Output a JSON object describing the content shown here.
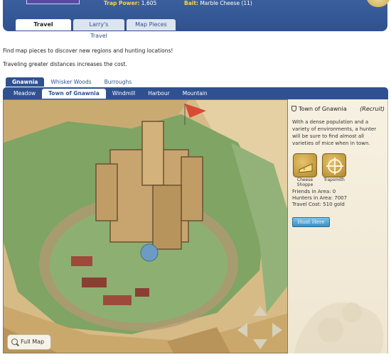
{
  "header": {
    "trap_power_label": "Trap Power:",
    "trap_power_value": "1,605",
    "bait_label": "Bait:",
    "bait_value": "Marble Cheese (11)"
  },
  "main_tabs": [
    {
      "label": "Travel",
      "active": true
    },
    {
      "label": "Larry's Travel",
      "active": false
    },
    {
      "label": "Map Pieces",
      "active": false
    }
  ],
  "intro": {
    "line1": "Find map pieces to discover new regions and hunting locations!",
    "line2": "Traveling greater distances increases the cost."
  },
  "region_tabs": [
    {
      "label": "Gnawnia",
      "active": true
    },
    {
      "label": "Whisker Woods",
      "active": false
    },
    {
      "label": "Burroughs",
      "active": false
    }
  ],
  "location_tabs": [
    {
      "label": "Meadow",
      "active": false
    },
    {
      "label": "Town of Gnawnia",
      "active": true
    },
    {
      "label": "Windmill",
      "active": false
    },
    {
      "label": "Harbour",
      "active": false
    },
    {
      "label": "Mountain",
      "active": false
    }
  ],
  "location": {
    "name": "Town of Gnawnia",
    "rank": "(Recruit)",
    "description": "With a dense population and a variety of environments, a hunter will be sure to find almost all varieties of mice when in town.",
    "shops": [
      {
        "label": "Cheese Shoppe",
        "icon": "cheese-icon"
      },
      {
        "label": "Trapsmith",
        "icon": "crosshair-icon"
      }
    ],
    "friends_in_area": "Friends in Area: 0",
    "hunters_in_area": "Hunters in Area: 7007",
    "travel_cost": "Travel Cost: 510 gold",
    "hunt_button": "Hunt Here"
  },
  "map": {
    "full_map_label": "Full Map",
    "nav_arrows": [
      "arrow-up-icon",
      "arrow-left-icon",
      "arrow-right-icon",
      "arrow-down-icon"
    ]
  },
  "colors": {
    "header_blue": "#2f5190",
    "tab_light": "#dce4f1",
    "parchment": "#f7f1e2",
    "hunt_button": "#3d8ec2"
  }
}
